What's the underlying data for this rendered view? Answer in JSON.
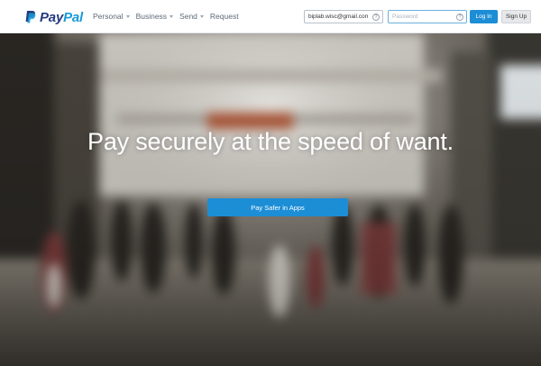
{
  "brand": {
    "name_part1": "Pay",
    "name_part2": "Pal",
    "color_dark": "#253b80",
    "color_light": "#179bd7"
  },
  "nav": {
    "items": [
      {
        "label": "Personal",
        "has_dropdown": true
      },
      {
        "label": "Business",
        "has_dropdown": true
      },
      {
        "label": "Send",
        "has_dropdown": true
      },
      {
        "label": "Request",
        "has_dropdown": false
      }
    ]
  },
  "login": {
    "email_value": "biplab.wisc@gmail.com",
    "password_placeholder": "Password",
    "help_symbol": "?",
    "login_label": "Log In",
    "signup_label": "Sign Up",
    "accent_color": "#1c8ed6"
  },
  "hero": {
    "headline": "Pay securely at the speed of want.",
    "cta_label": "Pay Safer in Apps"
  }
}
